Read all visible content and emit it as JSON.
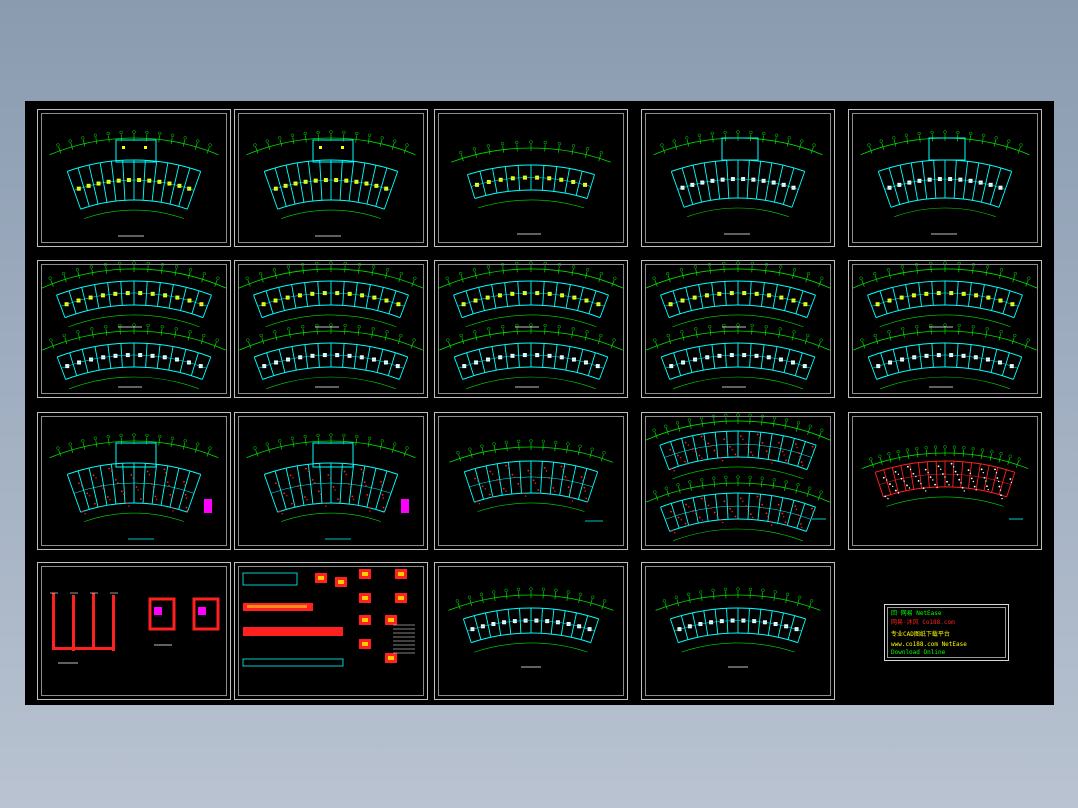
{
  "sheets": [
    {
      "id": "s1",
      "kind": "plan-filled"
    },
    {
      "id": "s2",
      "kind": "plan-filled"
    },
    {
      "id": "s3",
      "kind": "plan-small"
    },
    {
      "id": "s4",
      "kind": "plan-white"
    },
    {
      "id": "s5",
      "kind": "plan-white"
    },
    {
      "id": "s6",
      "kind": "double-plan"
    },
    {
      "id": "s7",
      "kind": "double-plan"
    },
    {
      "id": "s8",
      "kind": "double-plan"
    },
    {
      "id": "s9",
      "kind": "double-plan"
    },
    {
      "id": "s10",
      "kind": "double-plan"
    },
    {
      "id": "s11",
      "kind": "plan-rebar"
    },
    {
      "id": "s12",
      "kind": "plan-rebar"
    },
    {
      "id": "s13",
      "kind": "plan-rebar-small"
    },
    {
      "id": "s14",
      "kind": "double-rebar"
    },
    {
      "id": "s15",
      "kind": "plan-rebar-thin"
    },
    {
      "id": "s16",
      "kind": "elevation-red"
    },
    {
      "id": "s17",
      "kind": "details"
    },
    {
      "id": "s18",
      "kind": "plan-white-small"
    },
    {
      "id": "s19",
      "kind": "plan-white-small"
    }
  ],
  "title_block": {
    "line1": "回 网易 NetEase",
    "line2": "网易·沐风    Co188.com",
    "line3": "专业CAD图纸下载平台",
    "line4": "www.co188.com  NetEase",
    "line5": "Download  Online"
  },
  "colors": {
    "background": "#000000",
    "grid_green": "#00e000",
    "wall_cyan": "#00ffff",
    "column_yellow": "#ffff00",
    "rebar_red": "#ff2020",
    "accent_magenta": "#ff00ff",
    "line_white": "#ffffff"
  }
}
